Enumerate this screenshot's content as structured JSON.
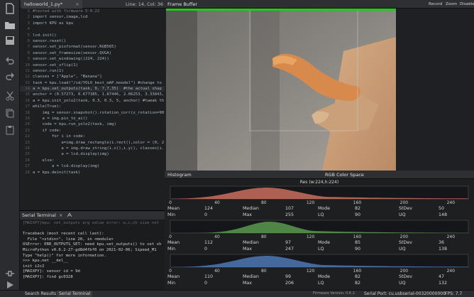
{
  "toolbar": {
    "icons": [
      "new-file-icon",
      "open-folder-icon",
      "save-icon",
      "undo-icon",
      "redo-icon",
      "cut-icon",
      "copy-icon",
      "paste-icon",
      "connect-icon",
      "run-icon"
    ]
  },
  "editor": {
    "file_tab": "helloworld_1.py*",
    "close_glyph": "×",
    "line_col": "Line: 14, Col: 36",
    "lines": [
      {
        "n": "1",
        "text": "#tested with firmware 5-0.22",
        "kind": "comment"
      },
      {
        "n": "2",
        "text": "import sensor,image,lcd",
        "kind": "code"
      },
      {
        "n": "3",
        "text": "import KPU as kpu",
        "kind": "code"
      },
      {
        "n": "4",
        "text": "",
        "kind": "code"
      },
      {
        "n": "5",
        "text": "lcd.init()",
        "kind": "code"
      },
      {
        "n": "6",
        "text": "sensor.reset()",
        "kind": "code"
      },
      {
        "n": "7",
        "text": "sensor.set_pixformat(sensor.RGB565)",
        "kind": "code"
      },
      {
        "n": "8",
        "text": "sensor.set_framesize(sensor.QVGA)",
        "kind": "code"
      },
      {
        "n": "9",
        "text": "sensor.set_windowing((224, 224))",
        "kind": "code"
      },
      {
        "n": "10",
        "text": "sensor.set_vflip(1)",
        "kind": "code"
      },
      {
        "n": "11",
        "text": "sensor.run(1)",
        "kind": "code"
      },
      {
        "n": "12",
        "text": "classes = [\"Apple\", \"Banana\"]",
        "kind": "code"
      },
      {
        "n": "13",
        "text": "task = kpu.load(\"/sd/YOLO_best_mAP.kmodel\") #change to",
        "kind": "code"
      },
      {
        "n": "14",
        "text": "a = kpu.set_outputs(task, 0, 7,7,35)  #the actual shap",
        "kind": "current"
      },
      {
        "n": "15",
        "text": "anchor = (0.57273, 0.677385, 1.87446, 2.06253, 3.33843,",
        "kind": "code"
      },
      {
        "n": "16",
        "text": "a = kpu.init_yolo2(task, 0.3, 0.3, 5, anchor) #tweak th",
        "kind": "code"
      },
      {
        "n": "17",
        "text": "while(True):",
        "kind": "code"
      },
      {
        "n": "18",
        "text": "    img = sensor.snapshot().rotation_corr(z_rotation=90",
        "kind": "code"
      },
      {
        "n": "19",
        "text": "    a = img.pix_to_ai()",
        "kind": "code"
      },
      {
        "n": "20",
        "text": "    code = kpu.run_yolo2(task, img)",
        "kind": "code"
      },
      {
        "n": "21",
        "text": "    if code:",
        "kind": "code"
      },
      {
        "n": "22",
        "text": "        for i in code:",
        "kind": "code"
      },
      {
        "n": "23",
        "text": "            a=img.draw_rectangle(i.rect(),color = (0, 2",
        "kind": "code"
      },
      {
        "n": "24",
        "text": "            a = img.draw_string(i.x(),i.y(), classes[i.",
        "kind": "code"
      },
      {
        "n": "25",
        "text": "            a = lcd.display(img)",
        "kind": "code"
      },
      {
        "n": "26",
        "text": "    else:",
        "kind": "code"
      },
      {
        "n": "27",
        "text": "        a = lcd.display(img)",
        "kind": "code"
      },
      {
        "n": "28",
        "text": "a = kpu.deinit(task)",
        "kind": "code"
      }
    ]
  },
  "serial": {
    "title": "Serial Terminal",
    "close_glyph": "×",
    "icon": "text-cursor-icon",
    "lines": [
      {
        "text": "[MAIXPY]kpu: set_outputs arg value error: w,c,ch size not",
        "dim": true
      },
      {
        "text": "",
        "dim": false
      },
      {
        "text": "Traceback (most recent call last):",
        "dim": false
      },
      {
        "text": "  File \"<stdin>\", line 20, in <module>",
        "dim": false
      },
      {
        "text": "OSError: ERR_OUTPUTS_SET: need kpu.set_outputs() to set sh",
        "dim": false
      },
      {
        "text": "MicroPython v0.6.2-27-gd8d4fbf0 on 2021-02-06; Sipeed_M1",
        "dim": false
      },
      {
        "text": "Type \"help()\" for more information.",
        "dim": false
      },
      {
        "text": ">>> kpu.net __del__",
        "dim": false
      },
      {
        "text": "init i2c2",
        "dim": false
      },
      {
        "text": "[MAIXPY]: sensor id = 9d",
        "dim": false
      },
      {
        "text": "[MAIXPY]: find gc0328",
        "dim": false
      }
    ]
  },
  "statusbar": {
    "search_results": "Search Results",
    "serial_terminal": "Serial Terminal",
    "firmware": "Firmware Version: 0.6.2",
    "serial_port": "Serial Port: cu.usbserial-00320000000",
    "fps": "FPS:   7.7"
  },
  "frame_buffer": {
    "title": "Frame Buffer",
    "record": "Record",
    "zoom": "Zoom",
    "disable": "Disable",
    "detection_box_color": "#1fc91f"
  },
  "histogram": {
    "title": "Histogram",
    "color_space": "RGB Color Space",
    "resolution": "Res (w:224,h:224)",
    "axis_ticks": [
      "0",
      "40",
      "80",
      "120",
      "160",
      "200",
      "240"
    ],
    "stat_labels": [
      "Mean",
      "Median",
      "Mode",
      "StDev",
      "Min",
      "Max",
      "LQ",
      "UQ"
    ],
    "channels": [
      {
        "name": "R",
        "color": "#c96f5d",
        "mean": "124",
        "median": "107",
        "mode": "82",
        "stdev": "50",
        "min": "0",
        "max": "255",
        "lq": "90",
        "uq": "148"
      },
      {
        "name": "G",
        "color": "#5a9a4e",
        "mean": "112",
        "median": "97",
        "mode": "85",
        "stdev": "36",
        "min": "0",
        "max": "247",
        "lq": "90",
        "uq": "138"
      },
      {
        "name": "B",
        "color": "#4f78b5",
        "mean": "110",
        "median": "99",
        "mode": "82",
        "stdev": "47",
        "min": "0",
        "max": "206",
        "lq": "82",
        "uq": "132"
      }
    ]
  }
}
